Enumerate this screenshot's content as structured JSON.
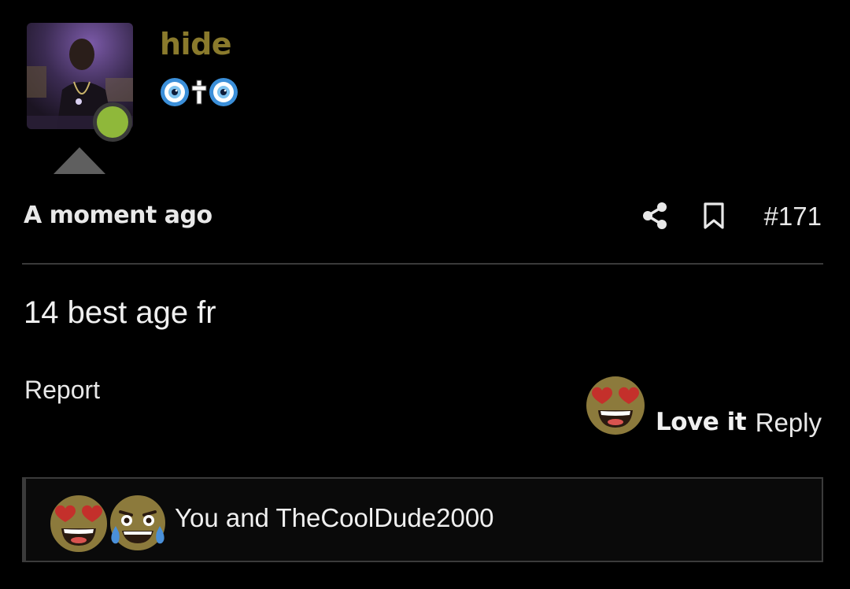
{
  "post": {
    "author": {
      "username": "hide",
      "title_icons": [
        "nazar-amulet-icon",
        "latin-cross-icon",
        "nazar-amulet-icon"
      ],
      "online": true
    },
    "time": "A moment ago",
    "number": "#171",
    "message": "14 best age fr"
  },
  "actions": {
    "report_label": "Report",
    "reaction_label": "Love it",
    "reply_label": "Reply"
  },
  "reactions_summary": {
    "icons": [
      "heart-eyes-emoji-icon",
      "tears-of-joy-emoji-icon"
    ],
    "text": "You and TheCoolDude2000"
  },
  "colors": {
    "background": "#000000",
    "username": "#8a7a2c",
    "online_dot": "#8fb83a",
    "text": "#e8e8e8",
    "divider": "#3a3a3a"
  }
}
